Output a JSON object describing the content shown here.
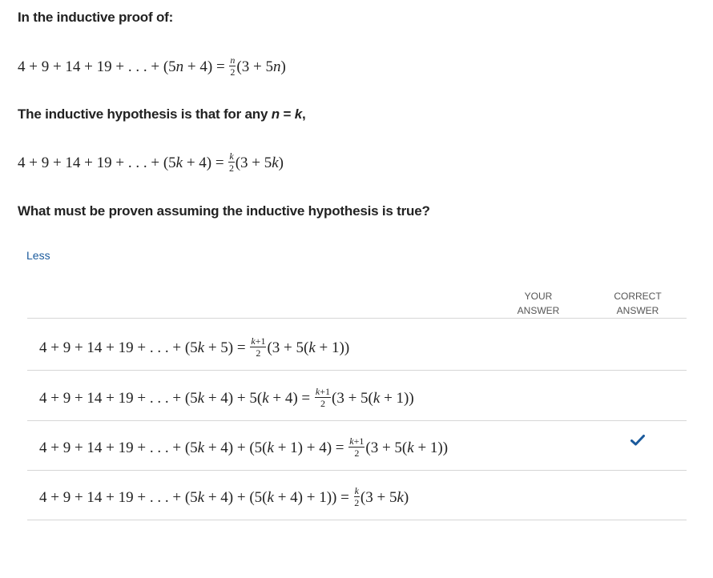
{
  "question": {
    "intro": "In the inductive proof of:",
    "hypothesis_text": "The inductive hypothesis is that for any n = k,",
    "prompt": "What must be proven assuming the inductive hypothesis is true?"
  },
  "less_link": "Less",
  "table": {
    "your_answer_header_1": "YOUR",
    "your_answer_header_2": "ANSWER",
    "correct_answer_header_1": "CORRECT",
    "correct_answer_header_2": "ANSWER",
    "options": [
      {
        "expr": "4 + 9 + 14 + 19 + ... + (5k + 5) = (k+1)/2 (3 + 5(k + 1))",
        "correct": false
      },
      {
        "expr": "4 + 9 + 14 + 19 + ... + (5k + 4) + 5(k + 4) = (k+1)/2 (3 + 5(k + 1))",
        "correct": false
      },
      {
        "expr": "4 + 9 + 14 + 19 + ... + (5k + 4) + (5(k + 1) + 4) = (k+1)/2 (3 + 5(k + 1))",
        "correct": true
      },
      {
        "expr": "4 + 9 + 14 + 19 + ... + (5k + 4) + (5(k + 4) + 1)) = k/2 (3 + 5k)",
        "correct": false
      }
    ]
  },
  "icons": {
    "correct_marker": "checkmark-icon"
  },
  "colors": {
    "link": "#1a5a9c",
    "check": "#1a5a9c",
    "divider": "#d6d6d6"
  }
}
